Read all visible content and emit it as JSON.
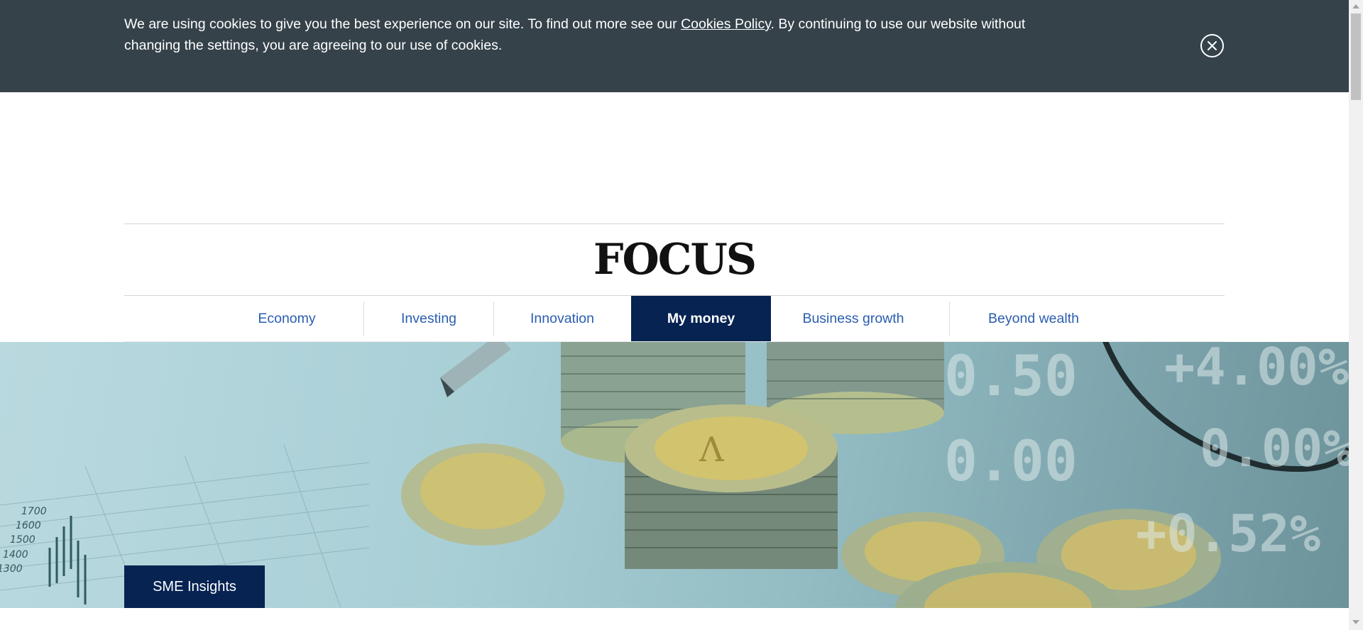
{
  "cookie_banner": {
    "text_before": "We are using cookies to give you the best experience on our site. To find out more see our ",
    "link_label": "Cookies Policy",
    "text_after": ". By continuing to use our website without changing the settings, you are agreeing to our use of cookies.",
    "close_icon": "close-icon"
  },
  "header": {
    "logo_text": "FOCUS"
  },
  "nav": {
    "items": [
      {
        "label": "Economy"
      },
      {
        "label": "Investing"
      },
      {
        "label": "Innovation"
      },
      {
        "label": "My money",
        "active": true
      },
      {
        "label": "Business growth"
      },
      {
        "label": "Beyond wealth"
      }
    ]
  },
  "hero": {
    "image": "coins-and-financial-chart",
    "tag_label": "SME Insights",
    "chart_numbers": [
      "0.50",
      "+4.00%",
      "0.00",
      "0.00%",
      "+0.52%",
      "1700",
      "1600",
      "1500",
      "1400",
      "1300"
    ]
  },
  "colors": {
    "cookie_bg": "#35424a",
    "nav_active_bg": "#062352",
    "nav_link": "#2a5db0",
    "tag_bg": "#062352"
  }
}
